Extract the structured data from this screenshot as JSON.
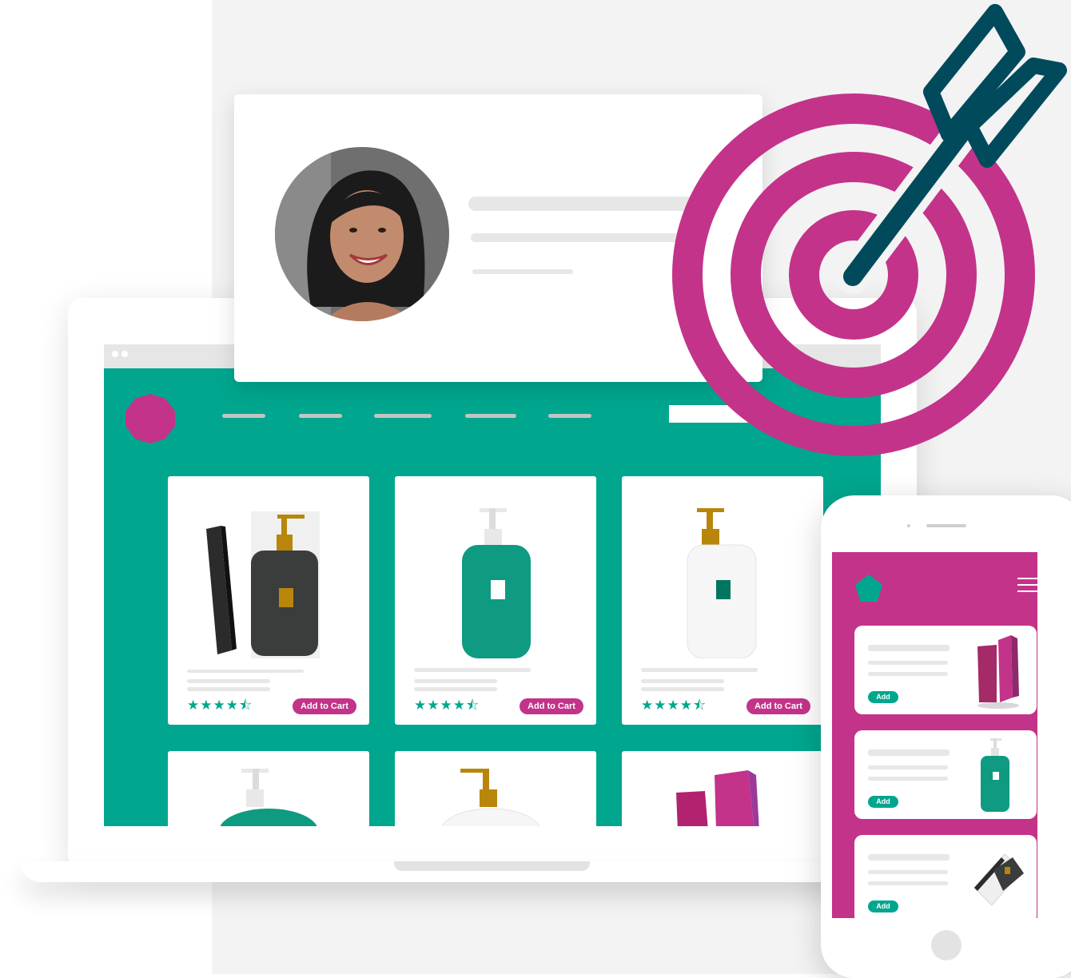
{
  "colors": {
    "teal": "#00a68e",
    "magenta": "#c3338a",
    "navy": "#004a5c",
    "placeholder_gray": "#e7e7e7"
  },
  "shop": {
    "products": [
      {
        "image": "dark-pump-bottle-with-box-icon",
        "rating": "★★★★⯪",
        "add_to_cart": "Add to Cart"
      },
      {
        "image": "teal-pump-bottle-icon",
        "rating": "★★★★⯪",
        "add_to_cart": "Add to Cart"
      },
      {
        "image": "white-pump-bottle-icon",
        "rating": "★★★★⯪",
        "add_to_cart": "Add to Cart"
      }
    ],
    "partial_products": [
      {
        "image": "teal-pump-bottle-icon"
      },
      {
        "image": "white-pump-bottle-icon"
      },
      {
        "image": "magenta-boxes-icon"
      }
    ]
  },
  "mobile": {
    "items": [
      {
        "image": "magenta-boxes-icon",
        "add_label": "Add"
      },
      {
        "image": "teal-pump-bottle-icon",
        "add_label": "Add"
      },
      {
        "image": "dark-bottle-in-box-icon",
        "add_label": "Add"
      }
    ]
  },
  "decor": {
    "target_icon": "target-with-arrow-icon",
    "avatar_icon": "user-avatar-photo"
  }
}
